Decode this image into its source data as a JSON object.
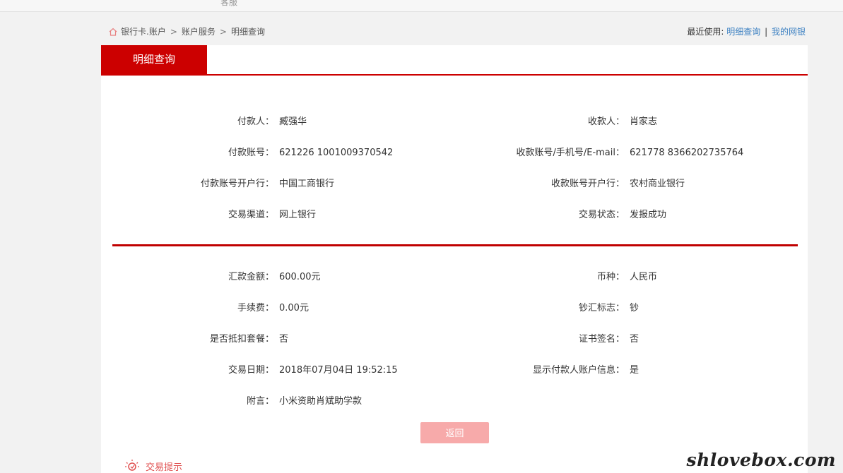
{
  "topbar": {
    "cut_text": "客服"
  },
  "breadcrumb": {
    "items": [
      "银行卡.账户",
      "账户服务",
      "明细查询"
    ],
    "separator": ">"
  },
  "recent": {
    "label": "最近使用:",
    "links": [
      "明细查询",
      "我的网银"
    ],
    "divider": "|"
  },
  "tab": {
    "title": "明细查询"
  },
  "payment": {
    "payer_label": "付款人：",
    "payer": "臧强华",
    "payee_label": "收款人：",
    "payee": "肖家志",
    "payer_account_label": "付款账号：",
    "payer_account": "621226 1001009370542",
    "payee_account_label": "收款账号/手机号/E-mail：",
    "payee_account": "621778 8366202735764",
    "payer_bank_label": "付款账号开户行：",
    "payer_bank": "中国工商银行",
    "payee_bank_label": "收款账号开户行：",
    "payee_bank": "农村商业银行",
    "channel_label": "交易渠道：",
    "channel": "网上银行",
    "status_label": "交易状态：",
    "status": "发报成功"
  },
  "details": {
    "amount_label": "汇款金额：",
    "amount": "600.00元",
    "currency_label": "币种：",
    "currency": "人民币",
    "fee_label": "手续费：",
    "fee": "0.00元",
    "cash_flag_label": "钞汇标志：",
    "cash_flag": "钞",
    "package_label": "是否抵扣套餐：",
    "package": "否",
    "cert_label": "证书签名：",
    "cert": "否",
    "date_label": "交易日期：",
    "date": "2018年07月04日 19:52:15",
    "show_payer_label": "显示付款人账户信息：",
    "show_payer": "是",
    "memo_label": "附言：",
    "memo": "小米资助肖斌助学款"
  },
  "buttons": {
    "back": "返回"
  },
  "tips": {
    "label": "交易提示",
    "icon": "lightbulb-icon"
  },
  "watermark": "shlovebox.com",
  "colors": {
    "accent": "#cc0000",
    "button": "#f7aaaa",
    "link": "#3a7fc1"
  }
}
